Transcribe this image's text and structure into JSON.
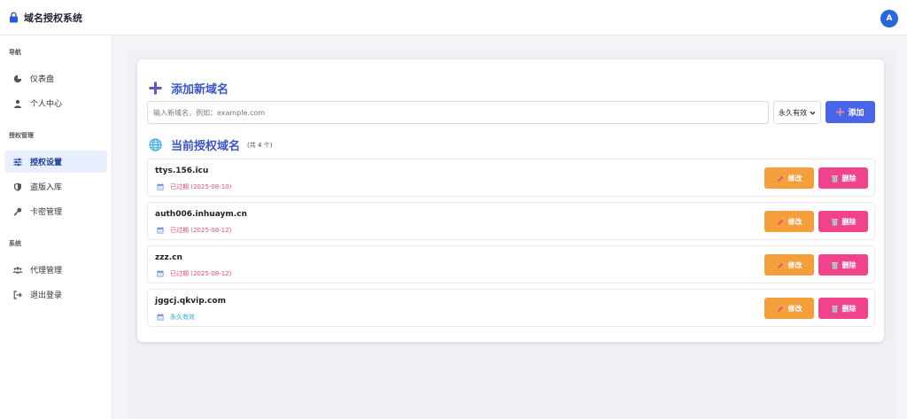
{
  "app": {
    "title": "域名授权系统",
    "avatar_letter": "A"
  },
  "sidebar": {
    "sections": [
      {
        "title": "导航",
        "items": [
          {
            "label": "仪表盘",
            "icon": "dashboard-icon"
          },
          {
            "label": "个人中心",
            "icon": "user-icon"
          }
        ]
      },
      {
        "title": "授权管理",
        "items": [
          {
            "label": "授权设置",
            "icon": "sliders-icon",
            "active": true
          },
          {
            "label": "盗版入库",
            "icon": "shield-icon"
          },
          {
            "label": "卡密管理",
            "icon": "key-icon"
          }
        ]
      },
      {
        "title": "系统",
        "items": [
          {
            "label": "代理管理",
            "icon": "users-icon"
          },
          {
            "label": "退出登录",
            "icon": "logout-icon"
          }
        ]
      }
    ]
  },
  "add_domain": {
    "title": "添加新域名",
    "placeholder": "输入新域名，例如：example.com",
    "duration_selected": "永久有效",
    "add_label": "添加"
  },
  "domains_section": {
    "title": "当前授权域名",
    "count_text": "(共 4 个)",
    "edit_label": "修改",
    "delete_label": "删除",
    "items": [
      {
        "name": "ttys.156.icu",
        "status": "已过期 (2025-08-10)",
        "state": "expired"
      },
      {
        "name": "auth006.inhuaym.cn",
        "status": "已过期 (2025-08-12)",
        "state": "expired"
      },
      {
        "name": "zzz.cn",
        "status": "已过期 (2025-08-12)",
        "state": "expired"
      },
      {
        "name": "jggcj.qkvip.com",
        "status": "永久有效",
        "state": "forever"
      }
    ]
  },
  "colors": {
    "accent": "#4a66e8",
    "edit": "#f49e3c",
    "delete": "#f0438d",
    "expired": "#e04a85",
    "forever": "#2aa7d8"
  }
}
